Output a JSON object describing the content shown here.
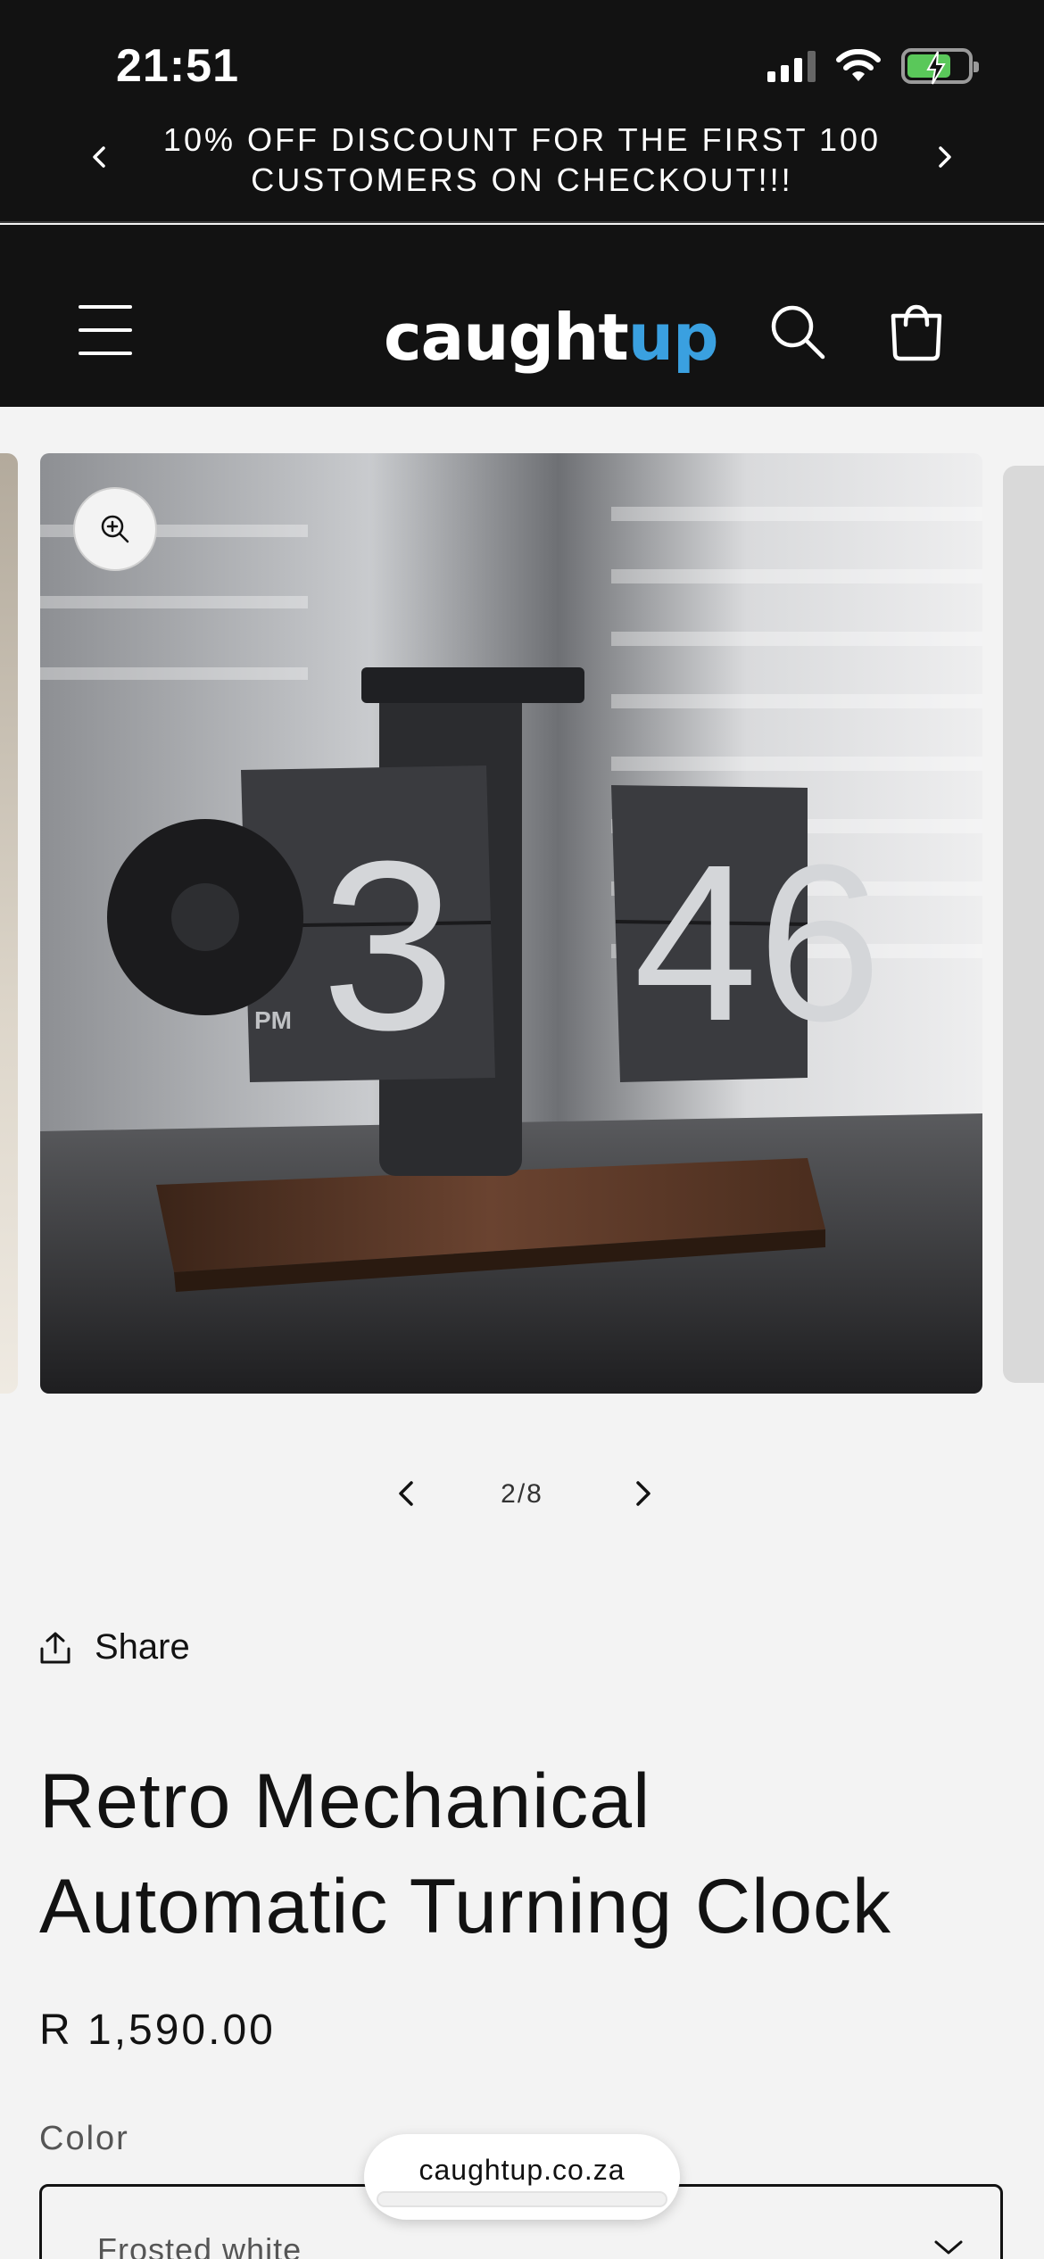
{
  "status_bar": {
    "time": "21:51",
    "battery_state": "charging"
  },
  "announcement": {
    "text": "10% OFF DISCOUNT FOR THE FIRST 100 CUSTOMERS ON CHECKOUT!!!"
  },
  "header": {
    "logo_part1": "caught",
    "logo_part2": "up",
    "logo_accent_color": "#3aa0e0",
    "background_color": "#121212"
  },
  "gallery": {
    "counter": "2/8",
    "current": 2,
    "total": 8,
    "image": {
      "hour": "3",
      "minute": "46",
      "period": "PM"
    }
  },
  "product": {
    "share_label": "Share",
    "title_line1": "Retro Mechanical",
    "title_line2": "Automatic Turning Clock",
    "price": "R 1,590.00",
    "color_label": "Color",
    "color_value": "Frosted white"
  },
  "browser": {
    "url": "caughtup.co.za"
  }
}
